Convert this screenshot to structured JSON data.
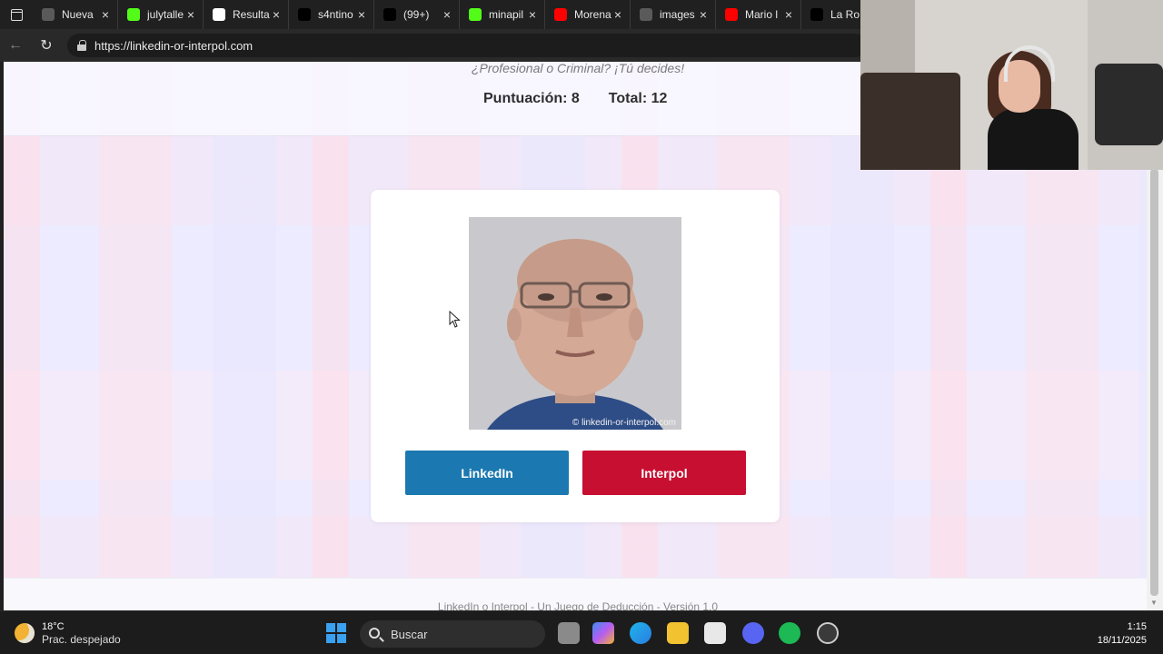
{
  "browser": {
    "tabs": [
      {
        "title": "Nueva",
        "icon": "new-tab-icon",
        "color": "#5a5a5a"
      },
      {
        "title": "julytalle",
        "icon": "kick-icon",
        "color": "#53fc18"
      },
      {
        "title": "Resulta",
        "icon": "google-icon",
        "color": "#ffffff"
      },
      {
        "title": "s4ntino",
        "icon": "x-icon",
        "color": "#000000"
      },
      {
        "title": "(99+)",
        "icon": "tiktok-icon",
        "color": "#000000"
      },
      {
        "title": "minapil",
        "icon": "kick-icon",
        "color": "#53fc18"
      },
      {
        "title": "Morena",
        "icon": "youtube-icon",
        "color": "#ff0000"
      },
      {
        "title": "images",
        "icon": "globe-icon",
        "color": "#5a5a5a"
      },
      {
        "title": "Mario l",
        "icon": "youtube-icon",
        "color": "#ff0000"
      },
      {
        "title": "La Ro",
        "icon": "tiktok-icon",
        "color": "#000000"
      }
    ],
    "url": "https://linkedin-or-interpol.com"
  },
  "page": {
    "tagline": "¿Profesional o Criminal? ¡Tú decides!",
    "score_label": "Puntuación: 8",
    "total_label": "Total: 12",
    "photo_watermark": "© linkedin-or-interpol.com",
    "linkedin_label": "LinkedIn",
    "interpol_label": "Interpol",
    "footer": "LinkedIn o Interpol - Un Juego de Deducción - Versión 1.0",
    "colors": {
      "linkedin": "#1b78b0",
      "interpol": "#c70f31"
    }
  },
  "taskbar": {
    "temperature": "18°C",
    "condition": "Prac. despejado",
    "search_placeholder": "Buscar",
    "time": "1:15",
    "date": "18/11/2025"
  }
}
